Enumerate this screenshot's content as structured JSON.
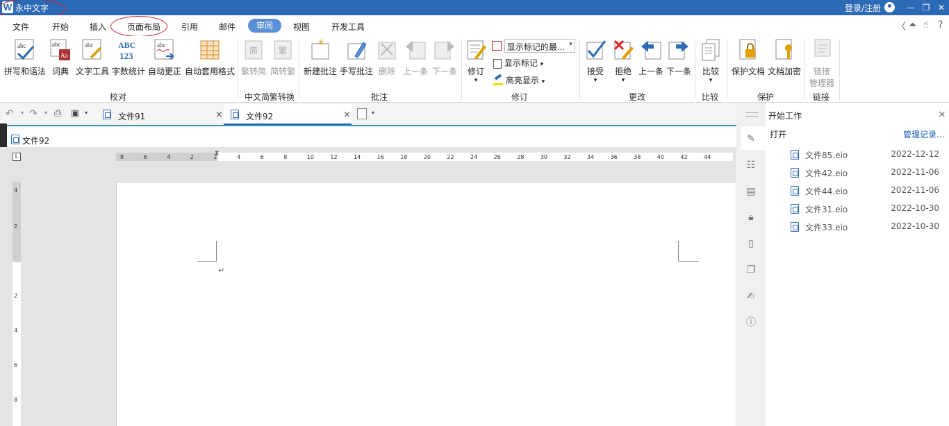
{
  "titlebar": {
    "logo": "W",
    "title": "永中文字",
    "login": "登录/注册"
  },
  "menu": {
    "items": [
      "文件",
      "开始",
      "插入",
      "页面布局",
      "引用",
      "邮件",
      "审阅",
      "视图",
      "开发工具"
    ],
    "active": "审阅"
  },
  "ribbon": {
    "proofing": {
      "spell": "拼写和语法",
      "dict": "词典",
      "texttool": "文字工具",
      "wordcount": "字数统计",
      "autocorrect": "自动更正",
      "autoformat": "自动套用格式",
      "group": "校对"
    },
    "chinese": {
      "to_simplified": "繁转简",
      "to_traditional": "简转繁",
      "group": "中文简繁转换"
    },
    "comments": {
      "new": "新建批注",
      "handwrite": "手写批注",
      "delete": "删除",
      "prev": "上一条",
      "next": "下一条",
      "group": "批注"
    },
    "tracking": {
      "revise": "修订",
      "display_select": "显示标记的最...",
      "show_markup": "显示标记",
      "highlight": "高亮显示",
      "group": "修订"
    },
    "changes": {
      "accept": "接受",
      "reject": "拒绝",
      "prev": "上一条",
      "next": "下一条",
      "group": "更改"
    },
    "compare": {
      "compare": "比较",
      "group": "比较"
    },
    "protect": {
      "protect_doc": "保护文档",
      "encrypt_doc": "文档加密",
      "group": "保护"
    },
    "links": {
      "link_manager_1": "链接",
      "link_manager_2": "管理器",
      "group": "链接"
    }
  },
  "tabs": [
    {
      "name": "文件91"
    },
    {
      "name": "文件92"
    }
  ],
  "document": {
    "crumb": "文件92"
  },
  "ruler": {
    "h_ticks": [
      "8",
      "6",
      "4",
      "2",
      "2",
      "4",
      "6",
      "8",
      "10",
      "12",
      "14",
      "16",
      "18",
      "20",
      "22",
      "24",
      "26",
      "28",
      "30",
      "32",
      "34",
      "36",
      "38",
      "40",
      "42",
      "44"
    ],
    "v_ticks": [
      "4",
      "2",
      "2",
      "4",
      "6",
      "8"
    ]
  },
  "taskpane": {
    "title": "开始工作",
    "open_label": "打开",
    "manage_link": "管理记录...",
    "recent": [
      {
        "name": "文件85.eio",
        "date": "2022-12-12"
      },
      {
        "name": "文件42.eio",
        "date": "2022-11-06"
      },
      {
        "name": "文件44.eio",
        "date": "2022-11-06"
      },
      {
        "name": "文件31.eio",
        "date": "2022-10-30"
      },
      {
        "name": "文件33.eio",
        "date": "2022-10-30"
      }
    ]
  }
}
